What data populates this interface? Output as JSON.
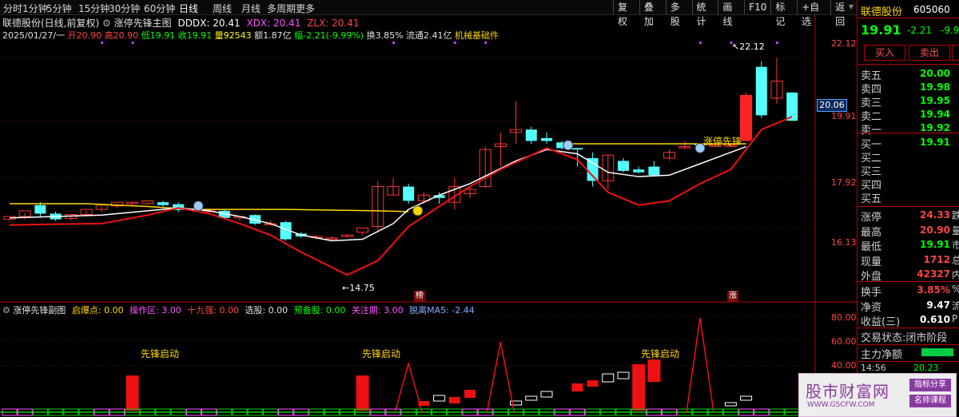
{
  "timeframes": [
    "分时",
    "1分钟",
    "5分钟",
    "15分钟",
    "30分钟",
    "60分钟",
    "日线",
    "周线",
    "月线",
    "多周期",
    "更多"
  ],
  "active_timeframe": "日线",
  "toolbar": [
    "复权",
    "叠加",
    "多股",
    "统计",
    "画线",
    "F10",
    "标记",
    "+自选",
    "返回"
  ],
  "header": {
    "title": "联德股份(日线,前复权)",
    "indicator": "涨停先锋主图",
    "ddx": "DDDX: 20.41",
    "xdx": "XDX: 20.41",
    "zlx": "ZLX: 20.41"
  },
  "info": {
    "date": "2025/01/27/一",
    "open": "开20.90",
    "high": "高20.90",
    "low": "低19.91",
    "close": "收19.91",
    "vol": "量92543",
    "amt": "额1.87亿",
    "amp": "幅-2.21(-9.99%)",
    "turn": "换3.85%",
    "float": "流通2.41亿",
    "sector": "机械基础件"
  },
  "price_axis": [
    "22.12",
    "19.91",
    "17.92",
    "16.13"
  ],
  "current_price_tag": "20.06",
  "annotations": {
    "high": "22.12",
    "low": "14.75",
    "signal": "涨停先锋",
    "bang": "榜",
    "zhang": "涨"
  },
  "sub": {
    "name": "涨停先锋副图",
    "qb": "启爆点: 0.00",
    "czq": "操作区: 3.00",
    "sjq": "十九强: 0.00",
    "xg": "选股: 0.00",
    "ybg": "预备股: 0.00",
    "gzq": "关注期: 3.00",
    "tl": "脱离MA5: -2.44",
    "axis": [
      "80.00",
      "60.00",
      "40.00"
    ],
    "label": "先锋启动"
  },
  "chart_data": {
    "type": "candlestick",
    "ylim": [
      14.0,
      22.8
    ],
    "candles": [
      [
        16.45,
        16.55,
        16.35,
        16.42
      ],
      [
        16.55,
        16.75,
        16.45,
        16.68
      ],
      [
        16.95,
        16.65,
        17.05,
        16.55
      ],
      [
        16.65,
        16.45,
        16.72,
        16.4
      ],
      [
        16.48,
        16.62,
        16.4,
        16.58
      ],
      [
        16.62,
        16.8,
        16.55,
        16.75
      ],
      [
        16.8,
        16.95,
        16.7,
        16.9
      ],
      [
        16.92,
        17.05,
        16.85,
        17.0
      ],
      [
        17.0,
        17.05,
        16.95,
        17.05
      ],
      [
        17.0,
        17.1,
        16.95,
        17.0
      ],
      [
        17.05,
        16.95,
        17.1,
        16.9
      ],
      [
        16.98,
        16.78,
        17.05,
        16.7
      ],
      [
        16.8,
        16.78,
        16.85,
        16.75
      ],
      [
        16.72,
        16.78,
        16.7,
        16.75
      ],
      [
        16.75,
        16.5,
        16.8,
        16.45
      ],
      [
        16.5,
        16.55,
        16.4,
        16.5
      ],
      [
        16.6,
        16.3,
        16.62,
        16.25
      ],
      [
        16.3,
        16.3,
        16.4,
        16.25
      ],
      [
        16.35,
        15.75,
        16.4,
        15.7
      ],
      [
        15.95,
        15.85,
        16.0,
        15.8
      ],
      [
        15.85,
        15.85,
        15.9,
        15.75
      ],
      [
        15.8,
        15.8,
        15.85,
        15.75
      ],
      [
        15.85,
        15.9,
        15.9,
        15.8
      ],
      [
        16.0,
        16.15,
        16.0,
        15.9
      ],
      [
        16.2,
        17.6,
        17.8,
        16.0
      ],
      [
        17.3,
        17.6,
        17.9,
        17.3
      ],
      [
        17.6,
        17.1,
        17.7,
        17.0
      ],
      [
        17.1,
        17.3,
        17.4,
        17.0
      ],
      [
        17.3,
        17.2,
        17.4,
        17.0
      ],
      [
        17.05,
        17.6,
        17.9,
        16.8
      ],
      [
        17.35,
        17.5,
        17.6,
        17.2
      ],
      [
        17.6,
        18.9,
        19.0,
        17.55
      ],
      [
        19.0,
        19.1,
        19.5,
        18.3
      ],
      [
        19.5,
        19.6,
        20.6,
        19.1
      ],
      [
        19.6,
        19.2,
        19.7,
        19.1
      ],
      [
        19.3,
        19.2,
        19.5,
        19.1
      ],
      [
        19.15,
        18.95,
        19.2,
        18.9
      ],
      [
        18.95,
        18.9,
        18.95,
        18.3
      ],
      [
        18.6,
        17.8,
        18.8,
        17.6
      ],
      [
        17.8,
        18.7,
        18.7,
        17.5
      ],
      [
        18.5,
        18.15,
        18.6,
        18.1
      ],
      [
        18.2,
        18.1,
        18.3,
        18.05
      ],
      [
        18.3,
        18.0,
        18.5,
        17.95
      ],
      [
        18.6,
        18.8,
        18.9,
        18.5
      ],
      [
        19.0,
        19.0,
        19.2,
        18.9
      ],
      [
        19.1,
        19.05,
        19.1,
        19.0
      ],
      [
        19.05,
        19.05,
        19.1,
        19.0
      ],
      [
        19.05,
        19.05,
        19.1,
        19.0
      ],
      [
        19.3,
        20.8,
        20.9,
        19.2
      ],
      [
        21.8,
        20.1,
        22.0,
        20.0
      ],
      [
        20.7,
        21.3,
        22.12,
        20.5
      ],
      [
        20.9,
        19.91,
        20.9,
        19.91
      ]
    ]
  }
}
